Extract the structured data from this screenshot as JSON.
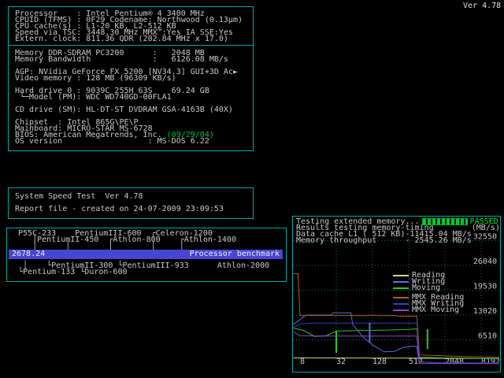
{
  "screen": {
    "version_label": "Ver 4.78"
  },
  "system_info": {
    "cpu_lines": [
      "Processor    : Intel Pentium® 4 3400 MHz",
      "CPUID (TFMS) : 0F29 Codename: Northwood (0.13µm)",
      "CPU cache(s) : L1-20 KB, L2-512 KB",
      "Speed via TSC: 3448.30 MHz MMX™:Yes IA SSE:Yes",
      "Extern. clock: 811.36 QDR (202.84 MHz x 17.0)"
    ],
    "detail_lines": [
      "Memory DDR-SDRAM PC3200      :   2048 MB",
      "Memory Bandwidth             :   6126.08 MB/s",
      "",
      "AGP: NVidia GeForce FX 5200 [NV34.3] GUI+3D Ac►",
      "Video memory : 128 MB (96309 KB/s)",
      "",
      "Hard drive 0 : 9039C 255H 63S    69.24 GB",
      " └─Model (PM): WDC WD740GD-00FLA1",
      "",
      "CD drive (SM): HL-DT-ST DVDRAM GSA-4163B (40X)",
      "",
      "Chipset  : Intel 865G\\PE\\P",
      "Mainboard: MICRO-STAR MS-6728",
      "",
      "OS version                  : MS-DOS 6.22"
    ],
    "bios_prefix": "BIOS: American Megatrends, Inc. ",
    "bios_date": "(09/29/04)"
  },
  "report_box": {
    "title": "System Speed Test  Ver 4.78",
    "subtitle": "Report file - created on 24-07-2009 23:09:53"
  },
  "benchmark_box": {
    "score": "2678.24",
    "bar_label": "Processor benchmark",
    "tree_above": [
      " P55C-233    PentiumIII-600  ┌Celeron-1200",
      "    │PentiumII-450  ┌Athlon-800    ┌Athlon-1400",
      "    │      │        │        │     │"
    ],
    "tree_below": [
      "  │    └PentiumII-300 └PentiumIII-933      Athlon-2000",
      " └Pentium-133 └Duron-600"
    ]
  },
  "chart_header": {
    "status_text": "Testing extended memory...",
    "passed_label": "PASSED",
    "result_lines": [
      "Results testing memory-timing        (MB/s)",
      "Data cache L1 ( 512 KB)-11415.04 MB/s",
      "Memory throughput      - 2545.26 MB/s"
    ]
  },
  "chart_data": {
    "type": "line",
    "title": "Results testing memory-timing",
    "ylabel": "MB/s",
    "x_unit": "KB",
    "x_scale": "log2",
    "x_ticks": [
      8,
      32,
      128,
      512,
      2048,
      8192
    ],
    "x_range": [
      6.2,
      16384
    ],
    "y_ticks": [
      6510,
      13020,
      19530,
      26040,
      32550
    ],
    "y_range": [
      0,
      32550
    ],
    "grid": true,
    "legend_position": "inside-right",
    "series": [
      {
        "name": "Reading",
        "color": "#d6d67a",
        "points": [
          [
            6.2,
            1750
          ],
          [
            512,
            1700
          ],
          [
            1024,
            1650
          ],
          [
            16384,
            1600
          ]
        ]
      },
      {
        "name": "Writing",
        "color": "#5c6ce6",
        "points": [
          [
            6.2,
            10500
          ],
          [
            10,
            13000
          ],
          [
            27,
            13050
          ],
          [
            28,
            13600
          ],
          [
            56,
            13600
          ],
          [
            60,
            10500
          ],
          [
            90,
            7200
          ],
          [
            130,
            5100
          ],
          [
            200,
            3350
          ],
          [
            300,
            3500
          ],
          [
            420,
            4550
          ],
          [
            600,
            4800
          ],
          [
            700,
            4750
          ],
          [
            760,
            800
          ],
          [
            1200,
            500
          ],
          [
            2500,
            420
          ],
          [
            8192,
            400
          ],
          [
            16384,
            380
          ]
        ]
      },
      {
        "name": "Moving",
        "color": "#2cc42c",
        "points": [
          [
            6.2,
            9600
          ],
          [
            9,
            9000
          ],
          [
            14,
            7400
          ],
          [
            22,
            7600
          ],
          [
            32,
            8800
          ],
          [
            80,
            8950
          ],
          [
            200,
            9050
          ],
          [
            512,
            9250
          ],
          [
            700,
            9400
          ],
          [
            770,
            1900
          ],
          [
            2000,
            1750
          ],
          [
            8192,
            1650
          ],
          [
            16384,
            1600
          ]
        ]
      },
      {
        "name": "MMX Reading",
        "color": "#b05c24",
        "points": [
          [
            6.2,
            23900
          ],
          [
            7.4,
            23900
          ],
          [
            8,
            12900
          ],
          [
            300,
            12900
          ],
          [
            350,
            12700
          ],
          [
            700,
            12700
          ],
          [
            770,
            2545
          ],
          [
            1500,
            2350
          ],
          [
            3500,
            2150
          ],
          [
            8192,
            2000
          ],
          [
            16384,
            1900
          ]
        ]
      },
      {
        "name": "MMX Writing",
        "color": "#3a3ab8",
        "points": [
          [
            6.2,
            9800
          ],
          [
            8,
            10700
          ],
          [
            14,
            10900
          ],
          [
            700,
            10900
          ],
          [
            770,
            650
          ],
          [
            2000,
            500
          ],
          [
            8192,
            440
          ],
          [
            16384,
            430
          ]
        ]
      },
      {
        "name": "MMX Moving",
        "color": "#9a3ccc",
        "points": [
          [
            6.2,
            8600
          ],
          [
            8,
            7600
          ],
          [
            16,
            7480
          ],
          [
            700,
            7480
          ],
          [
            770,
            320
          ],
          [
            2000,
            270
          ],
          [
            16384,
            260
          ]
        ]
      }
    ],
    "markers": [
      {
        "kb": 32,
        "from": 8900,
        "to": 3100,
        "color": "#2cc42c"
      },
      {
        "kb": 115,
        "from": 11000,
        "to": 5800,
        "color": "#5c6ce6"
      },
      {
        "kb": 1050,
        "from": 9300,
        "to": 4100,
        "color": "#2cc42c"
      }
    ]
  },
  "colors": {
    "border_cyan": "#00a8a8",
    "text": "#cacaca",
    "status_green": "#00c832",
    "bar_blue": "#4646d2",
    "background": "#000000"
  }
}
